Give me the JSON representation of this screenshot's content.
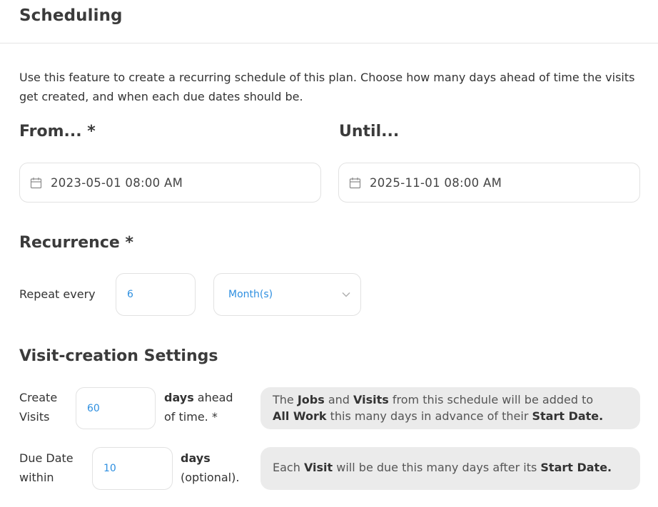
{
  "header": {
    "title": "Scheduling"
  },
  "intro": "Use this feature to create a recurring schedule of this plan. Choose how many days ahead of time the visits get created, and when each due dates should be.",
  "from": {
    "label": "From... *",
    "value": "2023-05-01 08:00 AM",
    "icon": "calendar-icon"
  },
  "until": {
    "label": "Until...",
    "value": "2025-11-01 08:00 AM",
    "icon": "calendar-icon"
  },
  "recurrence": {
    "heading": "Recurrence *",
    "repeat_label": "Repeat every",
    "interval": "6",
    "unit": "Month(s)",
    "unit_icon": "chevron-down-icon"
  },
  "visit_settings": {
    "heading": "Visit-creation Settings",
    "create": {
      "label_line1": "Create",
      "label_line2": "Visits",
      "value": "60",
      "suffix_bold": "days",
      "suffix_rest": " ahead",
      "suffix_line2": "of time. *",
      "hint": {
        "t1": "The ",
        "b1": "Jobs",
        "t2": " and ",
        "b2": "Visits",
        "t3": " from this schedule will be added to",
        "b3": "All Work",
        "t4": " this many days in advance of their ",
        "b4": "Start Date."
      }
    },
    "due": {
      "label_line1": "Due Date",
      "label_line2": "within",
      "value": "10",
      "suffix_bold": "days",
      "suffix_line2": "(optional).",
      "hint": {
        "t1": "Each ",
        "b1": "Visit",
        "t2": " will be due this many days after its ",
        "b2": "Start Date."
      }
    }
  }
}
